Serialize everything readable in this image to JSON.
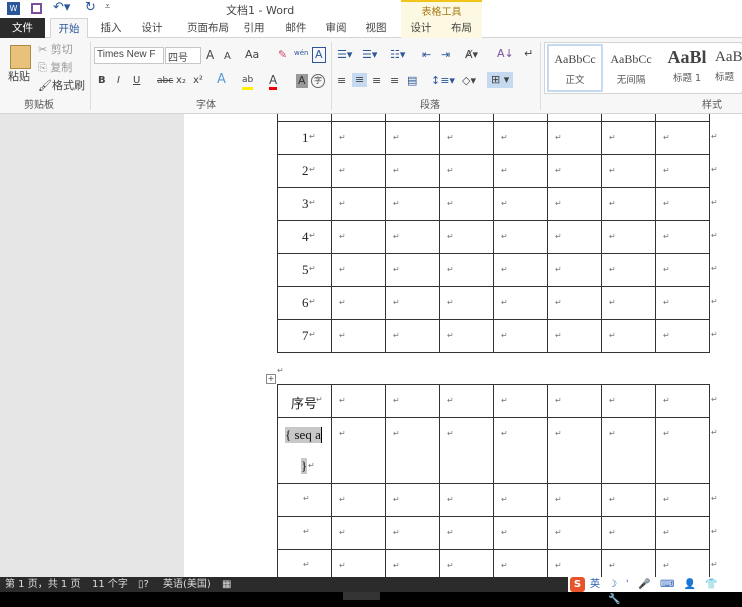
{
  "title": "文档1 - Word",
  "contextual_group": "表格工具",
  "tabs": [
    "文件",
    "开始",
    "插入",
    "设计",
    "页面布局",
    "引用",
    "邮件",
    "审阅",
    "视图"
  ],
  "context_tabs": [
    "设计",
    "布局"
  ],
  "clipboard": {
    "paste": "粘贴",
    "cut": "剪切",
    "copy": "复制",
    "format_painter": "格式刷",
    "group": "剪贴板"
  },
  "font": {
    "name": "Times New F",
    "size": "四号",
    "group": "字体",
    "bold": "B",
    "italic": "I",
    "underline": "U",
    "strike": "abc",
    "sub": "x₂",
    "sup": "x²",
    "grow": "A",
    "shrink": "A",
    "case": "Aa",
    "phonetic": "wén",
    "border_char": "A",
    "text_effect": "A",
    "highlight": "ab",
    "font_color": "A",
    "shading": "A",
    "enclose": "字"
  },
  "paragraph": {
    "group": "段落"
  },
  "styles": {
    "group": "样式",
    "items": [
      {
        "preview": "AaBbCc",
        "name": "正文"
      },
      {
        "preview": "AaBbCc",
        "name": "无间隔"
      },
      {
        "preview": "AaBl",
        "name": "标题 1"
      },
      {
        "preview": "AaB",
        "name": "标题"
      }
    ]
  },
  "table1": {
    "rows": [
      "1",
      "2",
      "3",
      "4",
      "5",
      "6",
      "7"
    ]
  },
  "table2": {
    "header": "序号",
    "seq_line1": "{ seq a",
    "seq_line2": "}"
  },
  "para_mark": "↵",
  "status": {
    "page": "第 1 页，共 1 页",
    "words": "11 个字",
    "language": "英语(美国)"
  },
  "ime": {
    "logo": "S",
    "mode": "英"
  }
}
